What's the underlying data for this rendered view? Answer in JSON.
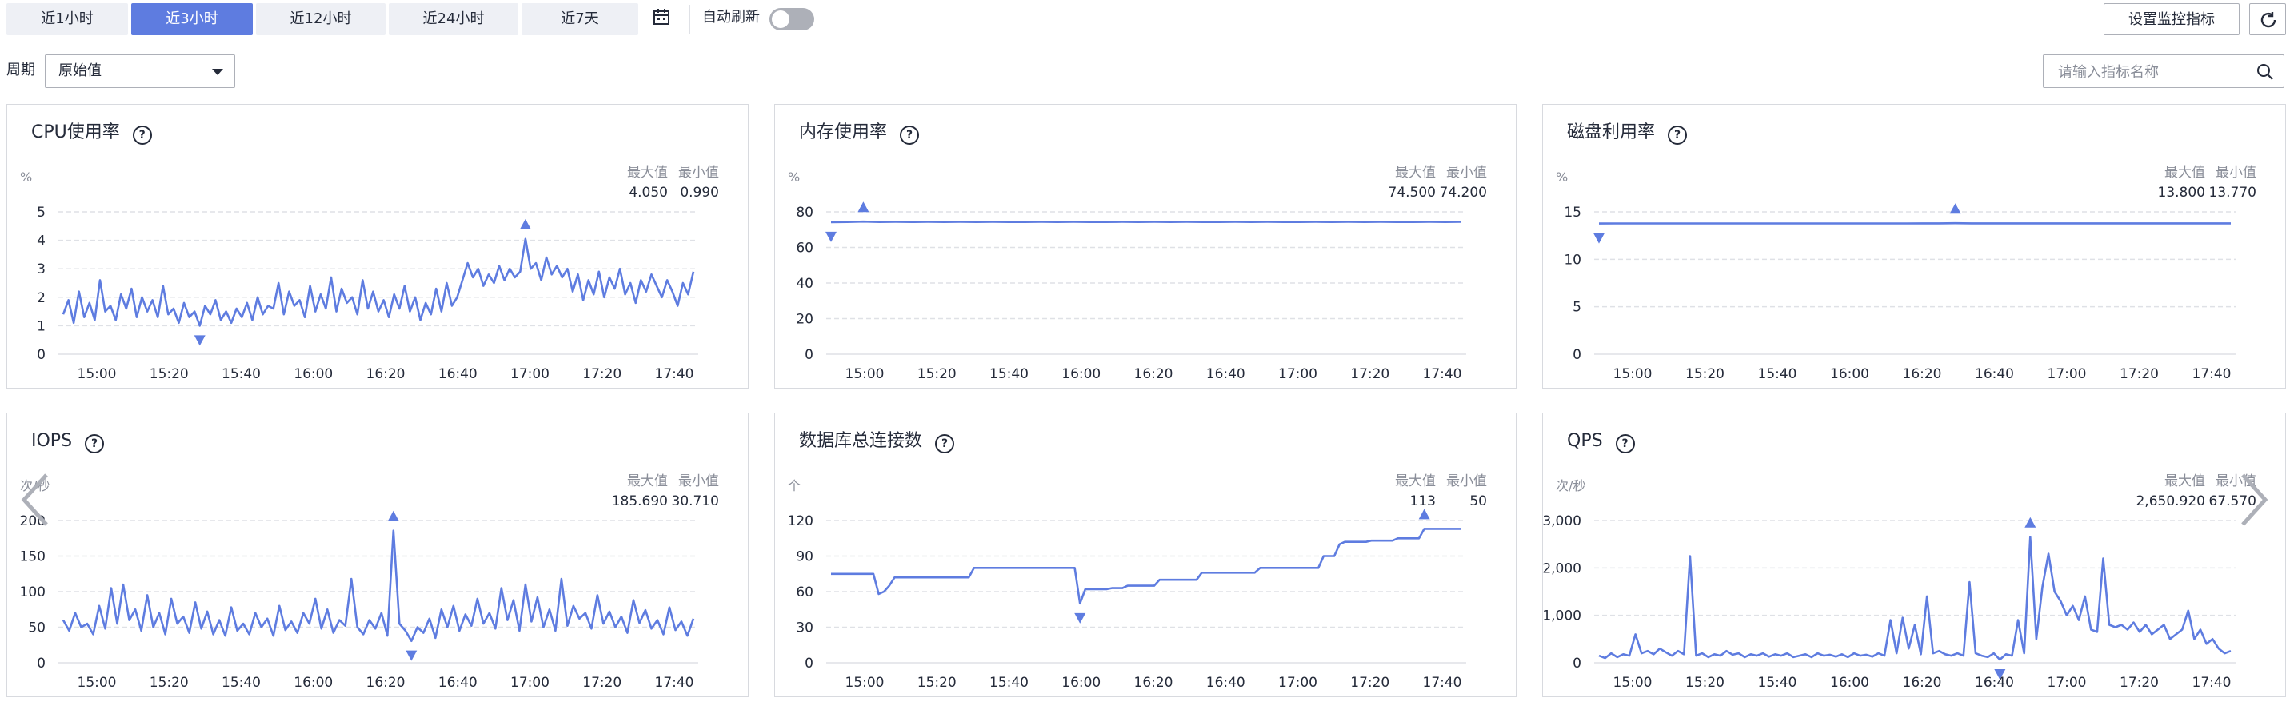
{
  "toolbar": {
    "ranges": [
      {
        "label": "近1小时",
        "active": false
      },
      {
        "label": "近3小时",
        "active": true
      },
      {
        "label": "近12小时",
        "active": false
      },
      {
        "label": "近24小时",
        "active": false
      },
      {
        "label": "近7天",
        "active": false
      }
    ],
    "calendar_icon": "calendar-icon",
    "auto_refresh_label": "自动刷新",
    "auto_refresh_on": false,
    "settings_button": "设置监控指标",
    "refresh_icon": "refresh-icon"
  },
  "filter": {
    "period_label": "周期",
    "period_value": "原始值",
    "search_placeholder": "请输入指标名称"
  },
  "colors": {
    "accent": "#5e7ce0",
    "line": "#5e7ce0",
    "grid": "#dfe1e6",
    "text_muted": "#8a8e99"
  },
  "chart_data": [
    {
      "type": "line",
      "title": "CPU使用率",
      "unit": "%",
      "max_label": "最大值",
      "min_label": "最小值",
      "max": "4.050",
      "min": "0.990",
      "y_ticks": [
        "0",
        "1",
        "2",
        "3",
        "4",
        "5"
      ],
      "ylim": [
        0,
        5
      ],
      "x_ticks": [
        "15:00",
        "15:20",
        "15:40",
        "16:00",
        "16:20",
        "16:40",
        "17:00",
        "17:20",
        "17:40"
      ],
      "values": [
        1.4,
        1.9,
        1.1,
        2.2,
        1.3,
        1.8,
        1.2,
        2.6,
        1.5,
        1.7,
        1.2,
        2.1,
        1.6,
        2.3,
        1.3,
        2.0,
        1.5,
        1.9,
        1.3,
        2.4,
        1.4,
        1.6,
        1.1,
        1.8,
        1.3,
        1.5,
        1.0,
        1.7,
        1.4,
        1.9,
        1.2,
        1.5,
        1.1,
        1.6,
        1.3,
        1.8,
        1.2,
        2.0,
        1.4,
        1.7,
        1.6,
        2.5,
        1.4,
        2.2,
        1.7,
        1.9,
        1.3,
        2.4,
        1.5,
        2.1,
        1.6,
        2.7,
        1.5,
        2.3,
        1.8,
        2.0,
        1.4,
        2.6,
        1.6,
        2.2,
        1.5,
        1.9,
        1.3,
        2.1,
        1.6,
        2.4,
        1.5,
        2.0,
        1.2,
        1.8,
        1.4,
        2.3,
        1.5,
        2.5,
        1.7,
        2.0,
        2.6,
        3.2,
        2.7,
        3.0,
        2.4,
        2.8,
        2.5,
        3.1,
        2.6,
        3.0,
        2.7,
        2.9,
        4.05,
        3.0,
        3.2,
        2.6,
        3.4,
        2.8,
        3.1,
        2.7,
        3.0,
        2.2,
        2.8,
        1.9,
        2.6,
        2.1,
        2.9,
        2.0,
        2.7,
        2.3,
        3.0,
        2.1,
        2.5,
        1.8,
        2.6,
        2.2,
        2.8,
        2.4,
        2.0,
        2.6,
        2.2,
        1.7,
        2.5,
        2.1,
        2.9
      ],
      "max_index": 88,
      "min_index": 26
    },
    {
      "type": "line",
      "title": "内存使用率",
      "unit": "%",
      "max_label": "最大值",
      "min_label": "最小值",
      "max": "74.500",
      "min": "74.200",
      "y_ticks": [
        "0",
        "20",
        "40",
        "60",
        "80"
      ],
      "ylim": [
        0,
        80
      ],
      "x_ticks": [
        "15:00",
        "15:20",
        "15:40",
        "16:00",
        "16:20",
        "16:40",
        "17:00",
        "17:20",
        "17:40"
      ],
      "values": [
        74.2,
        74.3,
        74.5,
        74.3,
        74.4,
        74.3,
        74.4,
        74.3,
        74.4,
        74.3,
        74.4,
        74.3,
        74.3,
        74.4,
        74.3,
        74.4,
        74.3,
        74.3,
        74.4,
        74.3,
        74.4,
        74.3,
        74.4,
        74.3,
        74.3,
        74.4,
        74.3,
        74.4,
        74.3,
        74.3,
        74.4,
        74.3,
        74.4,
        74.3,
        74.4,
        74.3,
        74.3,
        74.4,
        74.3,
        74.4
      ],
      "max_index": 2,
      "min_index": 0
    },
    {
      "type": "line",
      "title": "磁盘利用率",
      "unit": "%",
      "max_label": "最大值",
      "min_label": "最小值",
      "max": "13.800",
      "min": "13.770",
      "y_ticks": [
        "0",
        "5",
        "10",
        "15"
      ],
      "ylim": [
        0,
        15
      ],
      "x_ticks": [
        "15:00",
        "15:20",
        "15:40",
        "16:00",
        "16:20",
        "16:40",
        "17:00",
        "17:20",
        "17:40"
      ],
      "values": [
        13.77,
        13.78,
        13.78,
        13.78,
        13.78,
        13.78,
        13.78,
        13.78,
        13.78,
        13.78,
        13.78,
        13.78,
        13.78,
        13.78,
        13.78,
        13.78,
        13.78,
        13.78,
        13.78,
        13.78,
        13.79,
        13.79,
        13.8,
        13.79,
        13.79,
        13.79,
        13.79,
        13.79,
        13.79,
        13.79,
        13.79,
        13.79,
        13.79,
        13.79,
        13.79,
        13.79,
        13.79,
        13.79,
        13.79,
        13.79
      ],
      "max_index": 22,
      "min_index": 0
    },
    {
      "type": "line",
      "title": "IOPS",
      "unit": "次/秒",
      "max_label": "最大值",
      "min_label": "最小值",
      "max": "185.690",
      "min": "30.710",
      "y_ticks": [
        "0",
        "50",
        "100",
        "150",
        "200"
      ],
      "ylim": [
        0,
        200
      ],
      "x_ticks": [
        "15:00",
        "15:20",
        "15:40",
        "16:00",
        "16:20",
        "16:40",
        "17:00",
        "17:20",
        "17:40"
      ],
      "values": [
        60,
        45,
        70,
        50,
        55,
        40,
        80,
        48,
        105,
        55,
        110,
        60,
        75,
        45,
        95,
        50,
        70,
        40,
        90,
        55,
        65,
        42,
        85,
        48,
        72,
        40,
        60,
        38,
        78,
        45,
        55,
        40,
        70,
        50,
        62,
        38,
        80,
        46,
        58,
        42,
        70,
        55,
        90,
        48,
        75,
        42,
        60,
        52,
        118,
        50,
        40,
        60,
        48,
        70,
        38,
        185.69,
        55,
        45,
        30.71,
        50,
        42,
        62,
        35,
        75,
        50,
        80,
        45,
        68,
        52,
        90,
        55,
        70,
        48,
        105,
        60,
        88,
        45,
        110,
        58,
        92,
        50,
        75,
        45,
        118,
        52,
        80,
        62,
        70,
        48,
        95,
        55,
        72,
        50,
        65,
        42,
        88,
        56,
        74,
        48,
        60,
        40,
        78,
        46,
        58,
        38,
        62
      ],
      "max_index": 55,
      "min_index": 58
    },
    {
      "type": "line",
      "title": "数据库总连接数",
      "unit": "个",
      "max_label": "最大值",
      "min_label": "最小值",
      "max": "113",
      "min": "50",
      "y_ticks": [
        "0",
        "30",
        "60",
        "90",
        "120"
      ],
      "ylim": [
        0,
        120
      ],
      "x_ticks": [
        "15:00",
        "15:20",
        "15:40",
        "16:00",
        "16:20",
        "16:40",
        "17:00",
        "17:20",
        "17:40"
      ],
      "values": [
        75,
        75,
        75,
        75,
        75,
        75,
        75,
        75,
        75,
        58,
        60,
        65,
        72,
        72,
        72,
        72,
        72,
        72,
        72,
        72,
        72,
        72,
        72,
        72,
        72,
        72,
        72,
        80,
        80,
        80,
        80,
        80,
        80,
        80,
        80,
        80,
        80,
        80,
        80,
        80,
        80,
        80,
        80,
        80,
        80,
        80,
        80,
        50,
        62,
        62,
        62,
        62,
        62,
        63,
        63,
        63,
        65,
        65,
        65,
        65,
        65,
        65,
        70,
        70,
        70,
        70,
        70,
        70,
        70,
        70,
        76,
        76,
        76,
        76,
        76,
        76,
        76,
        76,
        76,
        76,
        76,
        80,
        80,
        80,
        80,
        80,
        80,
        80,
        80,
        80,
        80,
        80,
        80,
        90,
        90,
        90,
        100,
        102,
        102,
        102,
        102,
        102,
        103,
        103,
        103,
        103,
        103,
        105,
        105,
        105,
        105,
        105,
        113,
        113,
        113,
        113,
        113,
        113,
        113,
        113
      ],
      "max_index": 112,
      "min_index": 47
    },
    {
      "type": "line",
      "title": "QPS",
      "unit": "次/秒",
      "max_label": "最大值",
      "min_label": "最小值",
      "max": "2,650.920",
      "min": "67.570",
      "y_ticks": [
        "0",
        "1,000",
        "2,000",
        "3,000"
      ],
      "ylim": [
        0,
        3000
      ],
      "x_ticks": [
        "15:00",
        "15:20",
        "15:40",
        "16:00",
        "16:20",
        "16:40",
        "17:00",
        "17:20",
        "17:40"
      ],
      "values": [
        150,
        100,
        200,
        120,
        180,
        150,
        600,
        200,
        250,
        180,
        300,
        220,
        150,
        250,
        180,
        2250,
        150,
        200,
        120,
        180,
        150,
        250,
        170,
        200,
        120,
        180,
        150,
        200,
        130,
        180,
        150,
        200,
        120,
        150,
        180,
        120,
        200,
        150,
        170,
        130,
        180,
        120,
        200,
        150,
        170,
        130,
        200,
        150,
        900,
        200,
        950,
        300,
        800,
        180,
        1400,
        200,
        250,
        180,
        150,
        200,
        150,
        1700,
        200,
        150,
        120,
        200,
        67.57,
        180,
        150,
        900,
        200,
        2650.92,
        500,
        1600,
        2300,
        1500,
        1300,
        1000,
        1200,
        900,
        1400,
        700,
        650,
        2200,
        800,
        750,
        800,
        700,
        850,
        650,
        800,
        600,
        700,
        800,
        500,
        600,
        700,
        1100,
        500,
        700,
        400,
        500,
        300,
        200,
        250
      ],
      "max_index": 71,
      "min_index": 66
    }
  ]
}
